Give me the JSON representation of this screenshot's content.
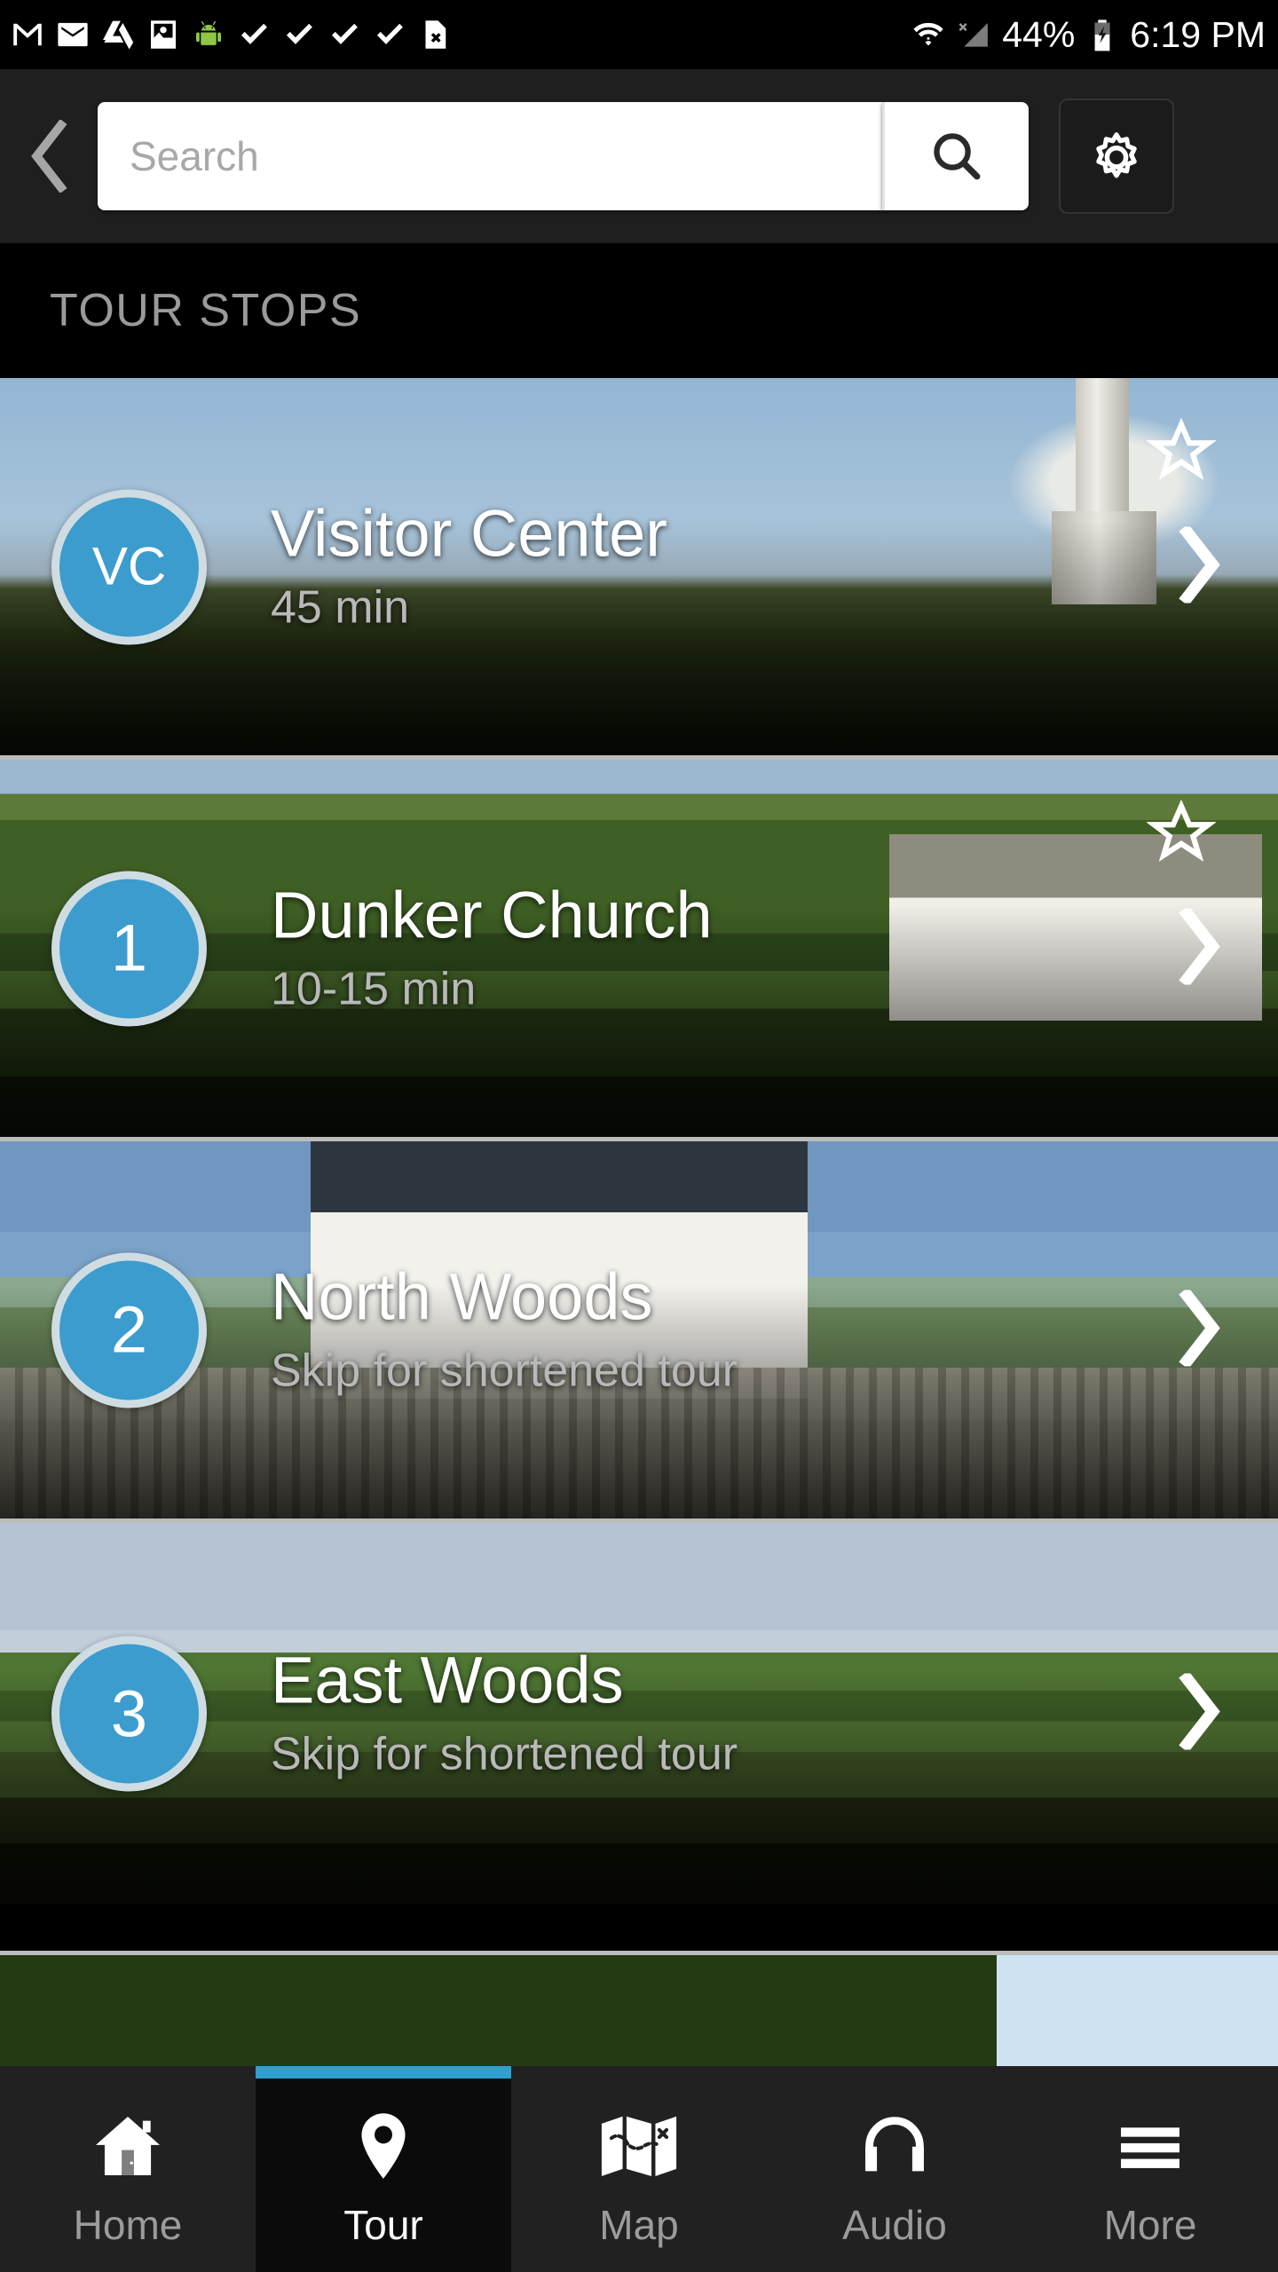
{
  "status_bar": {
    "notification_icons": [
      "gmail-icon",
      "gmail-icon",
      "google-drive-icon",
      "photos-icon",
      "android-icon",
      "checkmark-icon",
      "checkmark-icon",
      "checkmark-icon",
      "checkmark-icon",
      "file-error-icon"
    ],
    "wifi_icon": "wifi-icon",
    "signal_icon": "signal-no-service-icon",
    "battery_percent": "44%",
    "battery_icon": "battery-charging-icon",
    "time": "6:19 PM"
  },
  "toolbar": {
    "back_icon": "chevron-left-icon",
    "search_placeholder": "Search",
    "search_value": "",
    "search_button_icon": "search-icon",
    "settings_button_icon": "gear-icon"
  },
  "section": {
    "title": "TOUR STOPS"
  },
  "tour_stops": [
    {
      "badge": "VC",
      "badge_type": "letters",
      "title": "Visitor Center",
      "subtitle": "45 min",
      "starred": true,
      "star_icon": "star-outline-icon",
      "chevron_icon": "chevron-right-icon",
      "photo_alt": "cannons-on-field-with-monument"
    },
    {
      "badge": "1",
      "badge_type": "number",
      "title": "Dunker Church",
      "subtitle": "10-15 min",
      "starred": true,
      "star_icon": "star-outline-icon",
      "chevron_icon": "chevron-right-icon",
      "photo_alt": "white-church-building-with-trees"
    },
    {
      "badge": "2",
      "badge_type": "number",
      "title": "North Woods",
      "subtitle": "Skip for shortened tour",
      "starred": false,
      "star_icon": "star-outline-icon",
      "chevron_icon": "chevron-right-icon",
      "photo_alt": "white-farmhouse-with-picket-fence"
    },
    {
      "badge": "3",
      "badge_type": "number",
      "title": "East Woods",
      "subtitle": "Skip for shortened tour",
      "starred": false,
      "star_icon": "star-outline-icon",
      "chevron_icon": "chevron-right-icon",
      "photo_alt": "open-field-with-treeline"
    }
  ],
  "bottom_nav": {
    "items": [
      {
        "label": "Home",
        "icon": "home-icon",
        "active": false
      },
      {
        "label": "Tour",
        "icon": "map-pin-icon",
        "active": true
      },
      {
        "label": "Map",
        "icon": "folded-map-icon",
        "active": false
      },
      {
        "label": "Audio",
        "icon": "headphones-icon",
        "active": false
      },
      {
        "label": "More",
        "icon": "hamburger-menu-icon",
        "active": false
      }
    ]
  },
  "colors": {
    "accent_blue": "#3c9cce",
    "badge_ring": "#cfdde3",
    "toolbar_bg": "#1f1f1f",
    "tabbar_bg": "#212121",
    "active_tab_bg": "#0b0b0b",
    "separator": "#bcbcbc",
    "section_label": "#9a9a9a"
  }
}
